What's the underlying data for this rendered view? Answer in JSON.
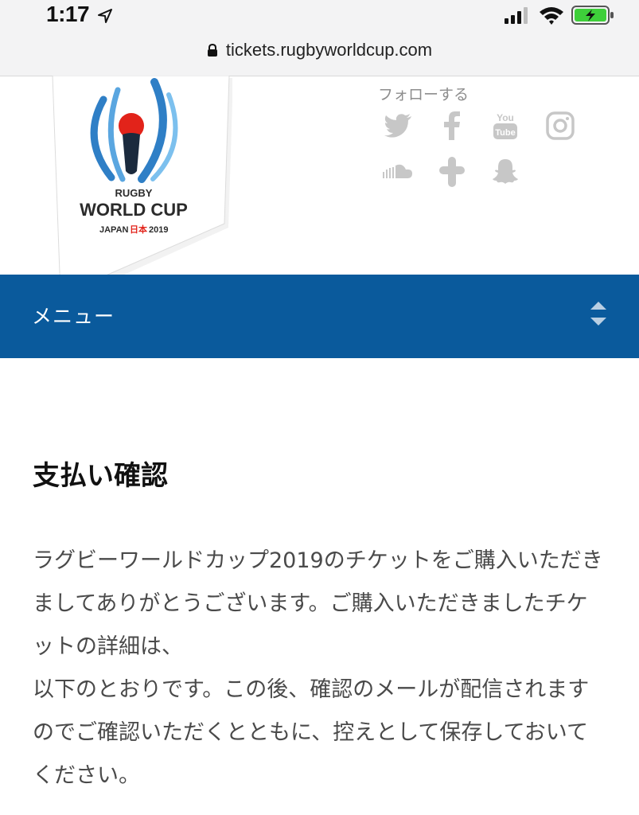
{
  "status_bar": {
    "time": "1:17"
  },
  "browser": {
    "url": "tickets.rugbyworldcup.com"
  },
  "logo": {
    "line1": "RUGBY",
    "line2": "WORLD CUP",
    "line3a": "JAPAN",
    "line3b": "日本",
    "line3c": "2019"
  },
  "follow": {
    "label": "フォローする",
    "icons": [
      "twitter-icon",
      "facebook-icon",
      "youtube-icon",
      "instagram-icon",
      "soundcloud-icon",
      "tumblr-icon",
      "snapchat-icon"
    ]
  },
  "menu": {
    "label": "メニュー"
  },
  "content": {
    "title": "支払い確認",
    "paragraph1": "ラグビーワールドカップ2019のチケットをご購入いただきましてありがとうございます。ご購入いただきましたチケットの詳細は、",
    "paragraph2": "以下のとおりです。この後、確認のメールが配信されますのでご確認いただくとともに、控えとして保存しておいてください。"
  },
  "colors": {
    "menu_bg": "#0a5a9c",
    "social_icon": "#c7c7c7",
    "battery": "#3ecf3a"
  }
}
